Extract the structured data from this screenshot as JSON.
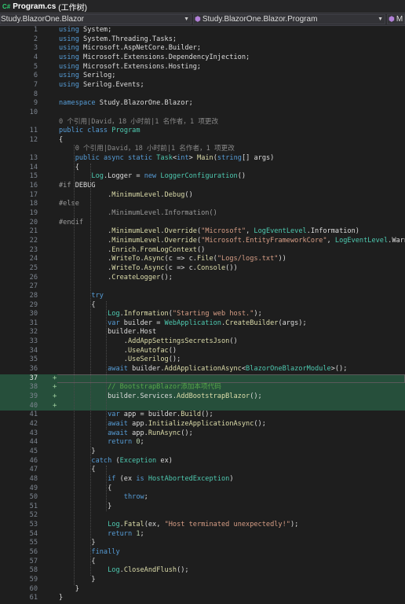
{
  "tab": {
    "icon": "C#",
    "file_name": "Program.cs",
    "state": "(工作树)"
  },
  "nav": {
    "project": "Study.BlazorOne.Blazor",
    "class": "Study.BlazorOne.Blazor.Program",
    "member": "M"
  },
  "colors": {
    "keyword": "#569cd6",
    "type": "#4ec9b0",
    "method": "#dcdcaa",
    "string": "#d69d85",
    "number": "#b5cea8",
    "comment": "#57a64a",
    "preproc": "#9b9b9b",
    "text": "#dcdcdc",
    "lens": "#8a8a8a",
    "added_bg": "#264f3b"
  },
  "lines": [
    {
      "n": 1,
      "tokens": [
        [
          "kw",
          "using"
        ],
        [
          "t",
          " System;"
        ]
      ]
    },
    {
      "n": 2,
      "tokens": [
        [
          "kw",
          "using"
        ],
        [
          "t",
          " System.Threading.Tasks;"
        ]
      ]
    },
    {
      "n": 3,
      "tokens": [
        [
          "kw",
          "using"
        ],
        [
          "t",
          " Microsoft.AspNetCore.Builder;"
        ]
      ]
    },
    {
      "n": 4,
      "tokens": [
        [
          "kw",
          "using"
        ],
        [
          "t",
          " Microsoft.Extensions.DependencyInjection;"
        ]
      ]
    },
    {
      "n": 5,
      "tokens": [
        [
          "kw",
          "using"
        ],
        [
          "t",
          " Microsoft.Extensions.Hosting;"
        ]
      ]
    },
    {
      "n": 6,
      "tokens": [
        [
          "kw",
          "using"
        ],
        [
          "t",
          " Serilog;"
        ]
      ]
    },
    {
      "n": 7,
      "tokens": [
        [
          "kw",
          "using"
        ],
        [
          "t",
          " Serilog.Events;"
        ]
      ]
    },
    {
      "n": 8,
      "tokens": []
    },
    {
      "n": 9,
      "tokens": [
        [
          "kw",
          "namespace"
        ],
        [
          "t",
          " Study.BlazorOne.Blazor;"
        ]
      ]
    },
    {
      "n": 10,
      "tokens": []
    },
    {
      "lens": "0 个引用|David，18 小时前|1 名作者，1 项更改",
      "indent": ""
    },
    {
      "n": 11,
      "tokens": [
        [
          "kw",
          "public"
        ],
        [
          "t",
          " "
        ],
        [
          "kw",
          "class"
        ],
        [
          "t",
          " "
        ],
        [
          "ty",
          "Program"
        ]
      ]
    },
    {
      "n": 12,
      "tokens": [
        [
          "t",
          "{"
        ]
      ]
    },
    {
      "lens": "0 个引用|David，18 小时前|1 名作者，1 项更改",
      "indent": "    "
    },
    {
      "n": 13,
      "tokens": [
        [
          "t",
          "    "
        ],
        [
          "kw",
          "public"
        ],
        [
          "t",
          " "
        ],
        [
          "kw",
          "async"
        ],
        [
          "t",
          " "
        ],
        [
          "kw",
          "static"
        ],
        [
          "t",
          " "
        ],
        [
          "ty",
          "Task"
        ],
        [
          "t",
          "<"
        ],
        [
          "kw",
          "int"
        ],
        [
          "t",
          "> "
        ],
        [
          "me",
          "Main"
        ],
        [
          "t",
          "("
        ],
        [
          "kw",
          "string"
        ],
        [
          "t",
          "[] args)"
        ]
      ]
    },
    {
      "n": 14,
      "tokens": [
        [
          "t",
          "    {"
        ]
      ]
    },
    {
      "n": 15,
      "tokens": [
        [
          "t",
          "        "
        ],
        [
          "ty",
          "Log"
        ],
        [
          "t",
          ".Logger = "
        ],
        [
          "kw",
          "new"
        ],
        [
          "t",
          " "
        ],
        [
          "ty",
          "LoggerConfiguration"
        ],
        [
          "t",
          "()"
        ]
      ]
    },
    {
      "n": 16,
      "tokens": [
        [
          "pp",
          "#if"
        ],
        [
          "t",
          " DEBUG"
        ]
      ]
    },
    {
      "n": 17,
      "tokens": [
        [
          "t",
          "            ."
        ],
        [
          "me",
          "MinimumLevel"
        ],
        [
          "t",
          "."
        ],
        [
          "me",
          "Debug"
        ],
        [
          "t",
          "()"
        ]
      ]
    },
    {
      "n": 18,
      "tokens": [
        [
          "pp",
          "#else"
        ]
      ]
    },
    {
      "n": 19,
      "tokens": [
        [
          "pp",
          "            .MinimumLevel.Information()"
        ]
      ]
    },
    {
      "n": 20,
      "tokens": [
        [
          "pp",
          "#endif"
        ]
      ]
    },
    {
      "n": 21,
      "tokens": [
        [
          "t",
          "            ."
        ],
        [
          "me",
          "MinimumLevel"
        ],
        [
          "t",
          "."
        ],
        [
          "me",
          "Override"
        ],
        [
          "t",
          "("
        ],
        [
          "st",
          "\"Microsoft\""
        ],
        [
          "t",
          ", "
        ],
        [
          "ty",
          "LogEventLevel"
        ],
        [
          "t",
          ".Information)"
        ]
      ]
    },
    {
      "n": 22,
      "tokens": [
        [
          "t",
          "            ."
        ],
        [
          "me",
          "MinimumLevel"
        ],
        [
          "t",
          "."
        ],
        [
          "me",
          "Override"
        ],
        [
          "t",
          "("
        ],
        [
          "st",
          "\"Microsoft.EntityFrameworkCore\""
        ],
        [
          "t",
          ", "
        ],
        [
          "ty",
          "LogEventLevel"
        ],
        [
          "t",
          ".Warning)"
        ]
      ]
    },
    {
      "n": 23,
      "tokens": [
        [
          "t",
          "            ."
        ],
        [
          "me",
          "Enrich"
        ],
        [
          "t",
          "."
        ],
        [
          "me",
          "FromLogContext"
        ],
        [
          "t",
          "()"
        ]
      ]
    },
    {
      "n": 24,
      "tokens": [
        [
          "t",
          "            ."
        ],
        [
          "me",
          "WriteTo"
        ],
        [
          "t",
          "."
        ],
        [
          "me",
          "Async"
        ],
        [
          "t",
          "(c => c."
        ],
        [
          "me",
          "File"
        ],
        [
          "t",
          "("
        ],
        [
          "st",
          "\"Logs/logs.txt\""
        ],
        [
          "t",
          "))"
        ]
      ]
    },
    {
      "n": 25,
      "tokens": [
        [
          "t",
          "            ."
        ],
        [
          "me",
          "WriteTo"
        ],
        [
          "t",
          "."
        ],
        [
          "me",
          "Async"
        ],
        [
          "t",
          "(c => c."
        ],
        [
          "me",
          "Console"
        ],
        [
          "t",
          "())"
        ]
      ]
    },
    {
      "n": 26,
      "tokens": [
        [
          "t",
          "            ."
        ],
        [
          "me",
          "CreateLogger"
        ],
        [
          "t",
          "();"
        ]
      ]
    },
    {
      "n": 27,
      "tokens": []
    },
    {
      "n": 28,
      "tokens": [
        [
          "t",
          "        "
        ],
        [
          "kw",
          "try"
        ]
      ]
    },
    {
      "n": 29,
      "tokens": [
        [
          "t",
          "        {"
        ]
      ]
    },
    {
      "n": 30,
      "tokens": [
        [
          "t",
          "            "
        ],
        [
          "ty",
          "Log"
        ],
        [
          "t",
          "."
        ],
        [
          "me",
          "Information"
        ],
        [
          "t",
          "("
        ],
        [
          "st",
          "\"Starting web host.\""
        ],
        [
          "t",
          ");"
        ]
      ]
    },
    {
      "n": 31,
      "tokens": [
        [
          "t",
          "            "
        ],
        [
          "kw",
          "var"
        ],
        [
          "t",
          " builder = "
        ],
        [
          "ty",
          "WebApplication"
        ],
        [
          "t",
          "."
        ],
        [
          "me",
          "CreateBuilder"
        ],
        [
          "t",
          "(args);"
        ]
      ]
    },
    {
      "n": 32,
      "tokens": [
        [
          "t",
          "            builder.Host"
        ]
      ]
    },
    {
      "n": 33,
      "tokens": [
        [
          "t",
          "                ."
        ],
        [
          "me",
          "AddAppSettingsSecretsJson"
        ],
        [
          "t",
          "()"
        ]
      ]
    },
    {
      "n": 34,
      "tokens": [
        [
          "t",
          "                ."
        ],
        [
          "me",
          "UseAutofac"
        ],
        [
          "t",
          "()"
        ]
      ]
    },
    {
      "n": 35,
      "tokens": [
        [
          "t",
          "                ."
        ],
        [
          "me",
          "UseSerilog"
        ],
        [
          "t",
          "();"
        ]
      ]
    },
    {
      "n": 36,
      "tokens": [
        [
          "t",
          "            "
        ],
        [
          "kw",
          "await"
        ],
        [
          "t",
          " builder."
        ],
        [
          "me",
          "AddApplicationAsync"
        ],
        [
          "t",
          "<"
        ],
        [
          "ty",
          "BlazorOneBlazorModule"
        ],
        [
          "t",
          ">();"
        ]
      ]
    },
    {
      "n": 37,
      "tokens": [],
      "added": true,
      "cur": true
    },
    {
      "n": 38,
      "tokens": [
        [
          "t",
          "            "
        ],
        [
          "cm",
          "// BootstrapBlazor添加本项代码"
        ]
      ],
      "added": true
    },
    {
      "n": 39,
      "tokens": [
        [
          "t",
          "            builder.Services."
        ],
        [
          "me",
          "AddBootstrapBlazor"
        ],
        [
          "t",
          "();"
        ]
      ],
      "added": true
    },
    {
      "n": 40,
      "tokens": [],
      "added": true
    },
    {
      "n": 41,
      "tokens": [
        [
          "t",
          "            "
        ],
        [
          "kw",
          "var"
        ],
        [
          "t",
          " app = builder."
        ],
        [
          "me",
          "Build"
        ],
        [
          "t",
          "();"
        ]
      ]
    },
    {
      "n": 42,
      "tokens": [
        [
          "t",
          "            "
        ],
        [
          "kw",
          "await"
        ],
        [
          "t",
          " app."
        ],
        [
          "me",
          "InitializeApplicationAsync"
        ],
        [
          "t",
          "();"
        ]
      ]
    },
    {
      "n": 43,
      "tokens": [
        [
          "t",
          "            "
        ],
        [
          "kw",
          "await"
        ],
        [
          "t",
          " app."
        ],
        [
          "me",
          "RunAsync"
        ],
        [
          "t",
          "();"
        ]
      ]
    },
    {
      "n": 44,
      "tokens": [
        [
          "t",
          "            "
        ],
        [
          "kw",
          "return"
        ],
        [
          "t",
          " "
        ],
        [
          "nu",
          "0"
        ],
        [
          "t",
          ";"
        ]
      ]
    },
    {
      "n": 45,
      "tokens": [
        [
          "t",
          "        }"
        ]
      ]
    },
    {
      "n": 46,
      "tokens": [
        [
          "t",
          "        "
        ],
        [
          "kw",
          "catch"
        ],
        [
          "t",
          " ("
        ],
        [
          "ty",
          "Exception"
        ],
        [
          "t",
          " ex)"
        ]
      ]
    },
    {
      "n": 47,
      "tokens": [
        [
          "t",
          "        {"
        ]
      ]
    },
    {
      "n": 48,
      "tokens": [
        [
          "t",
          "            "
        ],
        [
          "kw",
          "if"
        ],
        [
          "t",
          " (ex "
        ],
        [
          "kw",
          "is"
        ],
        [
          "t",
          " "
        ],
        [
          "ty",
          "HostAbortedException"
        ],
        [
          "t",
          ")"
        ]
      ]
    },
    {
      "n": 49,
      "tokens": [
        [
          "t",
          "            {"
        ]
      ]
    },
    {
      "n": 50,
      "tokens": [
        [
          "t",
          "                "
        ],
        [
          "kw",
          "throw"
        ],
        [
          "t",
          ";"
        ]
      ]
    },
    {
      "n": 51,
      "tokens": [
        [
          "t",
          "            }"
        ]
      ]
    },
    {
      "n": 52,
      "tokens": []
    },
    {
      "n": 53,
      "tokens": [
        [
          "t",
          "            "
        ],
        [
          "ty",
          "Log"
        ],
        [
          "t",
          "."
        ],
        [
          "me",
          "Fatal"
        ],
        [
          "t",
          "(ex, "
        ],
        [
          "st",
          "\"Host terminated unexpectedly!\""
        ],
        [
          "t",
          ");"
        ]
      ]
    },
    {
      "n": 54,
      "tokens": [
        [
          "t",
          "            "
        ],
        [
          "kw",
          "return"
        ],
        [
          "t",
          " "
        ],
        [
          "nu",
          "1"
        ],
        [
          "t",
          ";"
        ]
      ]
    },
    {
      "n": 55,
      "tokens": [
        [
          "t",
          "        }"
        ]
      ]
    },
    {
      "n": 56,
      "tokens": [
        [
          "t",
          "        "
        ],
        [
          "kw",
          "finally"
        ]
      ]
    },
    {
      "n": 57,
      "tokens": [
        [
          "t",
          "        {"
        ]
      ]
    },
    {
      "n": 58,
      "tokens": [
        [
          "t",
          "            "
        ],
        [
          "ty",
          "Log"
        ],
        [
          "t",
          "."
        ],
        [
          "me",
          "CloseAndFlush"
        ],
        [
          "t",
          "();"
        ]
      ]
    },
    {
      "n": 59,
      "tokens": [
        [
          "t",
          "        }"
        ]
      ]
    },
    {
      "n": 60,
      "tokens": [
        [
          "t",
          "    }"
        ]
      ]
    },
    {
      "n": 61,
      "tokens": [
        [
          "t",
          "}"
        ]
      ]
    }
  ]
}
